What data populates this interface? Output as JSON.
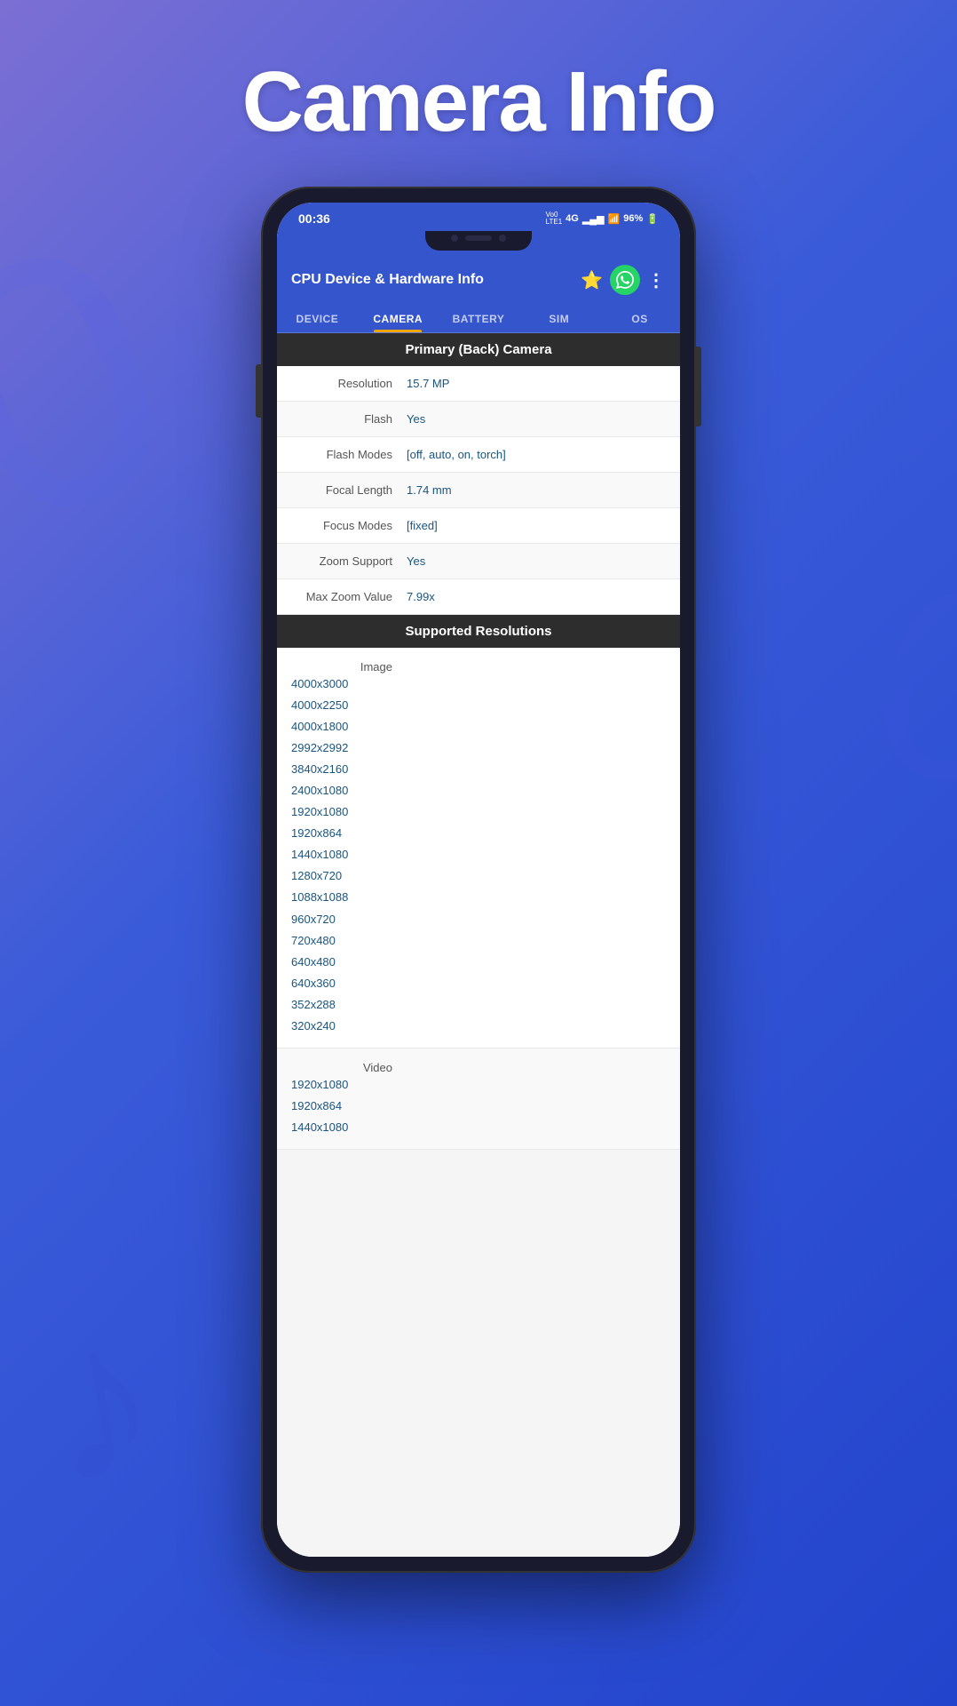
{
  "page": {
    "title": "Camera Info",
    "background_gradient": "linear-gradient(135deg, #7c6fd4 0%, #3a5bd9 40%, #2244cc 100%)"
  },
  "status_bar": {
    "time": "00:36",
    "network_type": "VoLTE 4G",
    "signal_bars": "▂▄▆",
    "battery": "96%"
  },
  "app_header": {
    "title": "CPU Device & Hardware Info",
    "star_icon": "⭐",
    "whatsapp_icon": "💬",
    "menu_icon": "⋮"
  },
  "tabs": [
    {
      "label": "DEVICE",
      "active": false
    },
    {
      "label": "CAMERA",
      "active": true
    },
    {
      "label": "BATTERY",
      "active": false
    },
    {
      "label": "SIM",
      "active": false
    },
    {
      "label": "OS",
      "active": false
    }
  ],
  "camera_info": {
    "primary_section_title": "Primary (Back) Camera",
    "fields": [
      {
        "label": "Resolution",
        "value": "15.7 MP"
      },
      {
        "label": "Flash",
        "value": "Yes"
      },
      {
        "label": "Flash Modes",
        "value": "[off, auto, on, torch]"
      },
      {
        "label": "Focal Length",
        "value": "1.74 mm"
      },
      {
        "label": "Focus Modes",
        "value": "[fixed]"
      },
      {
        "label": "Zoom Support",
        "value": "Yes"
      },
      {
        "label": "Max Zoom Value",
        "value": "7.99x"
      }
    ],
    "supported_resolutions_title": "Supported Resolutions",
    "image_label": "Image",
    "image_resolutions": [
      "4000x3000",
      "4000x2250",
      "4000x1800",
      "2992x2992",
      "3840x2160",
      "2400x1080",
      "1920x1080",
      "1920x864",
      "1440x1080",
      "1280x720",
      "1088x1088",
      "960x720",
      "720x480",
      "640x480",
      "640x360",
      "352x288",
      "320x240"
    ],
    "video_label": "Video",
    "video_resolutions": [
      "1920x1080",
      "1920x864",
      "1440x1080"
    ]
  }
}
